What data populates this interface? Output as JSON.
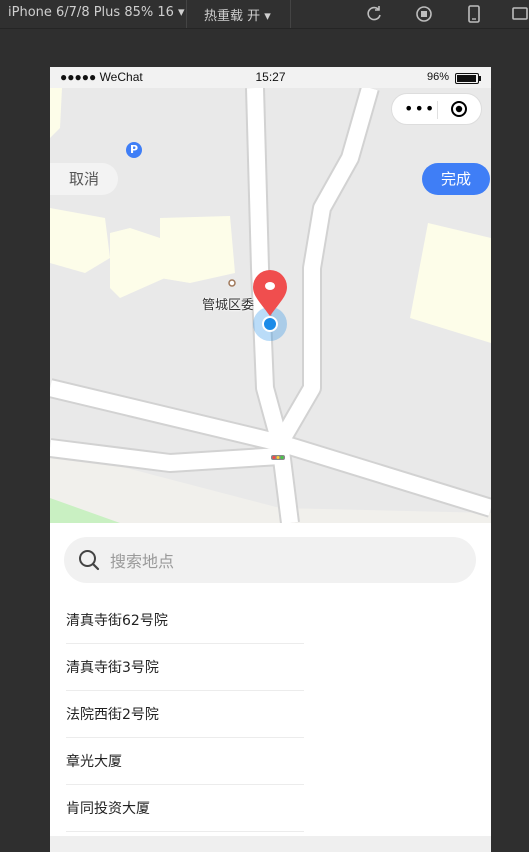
{
  "devtools": {
    "device_label": "iPhone 6/7/8 Plus 85% 16 ▾",
    "hot_reload_label": "热重载 开 ▾",
    "tools": [
      "refresh-icon",
      "stop-icon",
      "phone-icon",
      "device-icon"
    ]
  },
  "status_bar": {
    "carrier": "●●●●● WeChat",
    "time": "15:27",
    "battery": "96%"
  },
  "capsule": {
    "more": "•••"
  },
  "map": {
    "cancel_label": "取消",
    "done_label": "完成",
    "poi_label": "管城区委",
    "parking_symbol": "P",
    "colors": {
      "road": "#ffffff",
      "ground": "#e9e9e9",
      "building": "#fdfde9",
      "green": "#c9f0c2",
      "pin": "#f04e4e",
      "location": "#1a8be8",
      "done": "#3f7ef6"
    }
  },
  "search": {
    "placeholder": "搜索地点"
  },
  "results": [
    "清真寺街62号院",
    "清真寺街3号院",
    "法院西街2号院",
    "章光大厦",
    "肯同投资大厦"
  ]
}
